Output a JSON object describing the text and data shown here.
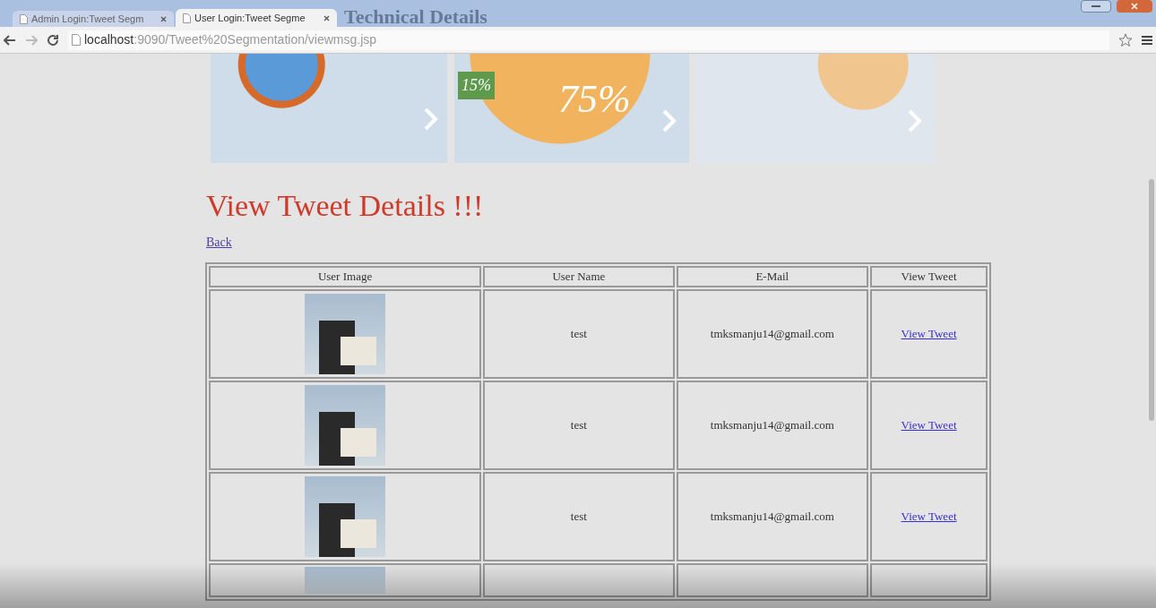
{
  "browser": {
    "tabs": [
      {
        "label": "Admin Login:Tweet Segm",
        "selected": false
      },
      {
        "label": "User Login:Tweet Segme",
        "selected": true
      }
    ],
    "backdrop_text": "Technical Details",
    "address": {
      "host": "localhost",
      "path": ":9090/Tweet%20Segmentation/viewmsg.jsp"
    }
  },
  "page": {
    "banner_labels": [
      "15%",
      "75%"
    ],
    "heading": "View Tweet Details !!!",
    "back_link": "Back",
    "table": {
      "columns": [
        "User Image",
        "User Name",
        "E-Mail",
        "View Tweet"
      ],
      "rows": [
        {
          "user_name": "test",
          "email": "tmksmanju14@gmail.com",
          "link": "View Tweet"
        },
        {
          "user_name": "test",
          "email": "tmksmanju14@gmail.com",
          "link": "View Tweet"
        },
        {
          "user_name": "test",
          "email": "tmksmanju14@gmail.com",
          "link": "View Tweet"
        }
      ]
    }
  }
}
